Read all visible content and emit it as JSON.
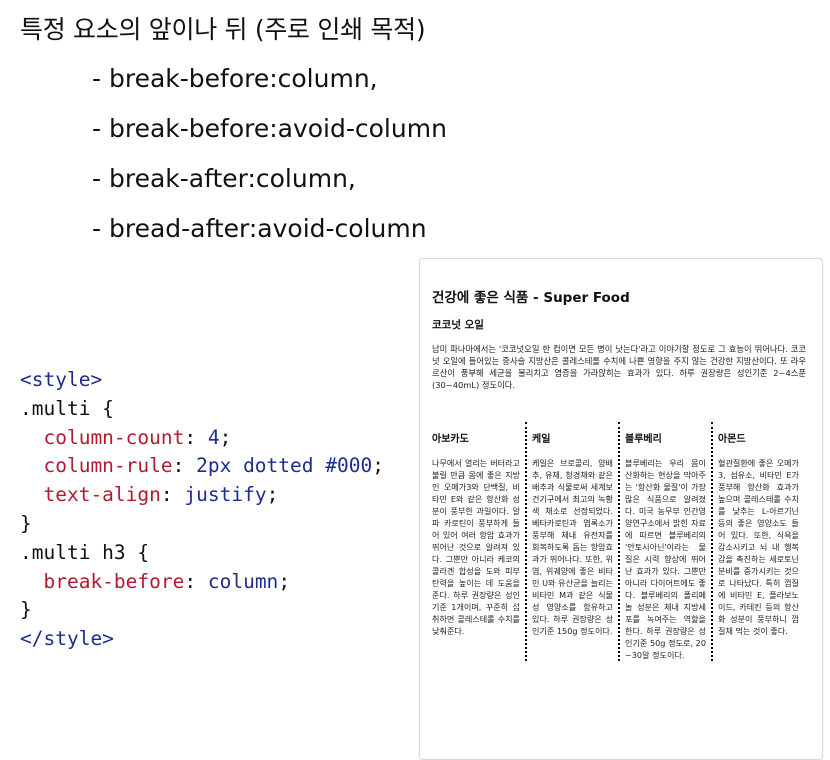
{
  "slide": {
    "title": "특정 요소의 앞이나 뒤 (주로 인쇄 목적)",
    "bullets": [
      "- break-before:column,",
      "- break-before:avoid-column",
      "- break-after:column,",
      "- bread-after:avoid-column"
    ]
  },
  "code": {
    "style_open": "<style>",
    "rule1_selector": ".multi {",
    "rule1_p1": "column-count",
    "rule1_v1": "4",
    "rule1_p2": "column-rule",
    "rule1_v2": "2px dotted #000",
    "rule1_p3": "text-align",
    "rule1_v3": "justify",
    "close_brace": "}",
    "rule2_selector": ".multi h3 {",
    "rule2_p1": "break-before",
    "rule2_v1": "column",
    "style_close": "</style>"
  },
  "demo": {
    "title": "건강에 좋은 식품 - Super Food",
    "section_title": "코코넛 오일",
    "intro": "남미 파나마에서는 '코코넛오일 한 컵이면 모든 병이 낫는다'라고 이야기할 정도로 그 효능이 뛰어나다. 코코넛 오일에 들어있는 중사슬 지방산은 콜레스테롤 수치에 나쁜 영향을 주지 않는 건강한 지방산이다. 또 라우르산이 풍부해 세균을 물리치고 염증을 가라앉히는 효과가 있다. 하루 권장량은 성인기준 2~4스푼(30~40mL) 정도이다.",
    "columns": [
      {
        "heading": "아보카도",
        "text": "나무에서 열리는 버터라고 불릴 만큼 몸에 좋은 지방인 오메가3와 단백질, 비타민 E와 같은 항산화 성분이 풍부한 과일이다. 알파 카로틴이 풍부하게 들어 있어 여러 항암 효과가 뛰어난 것으로 알려져 있다. 그뿐만 아니라 케코의 콜라겐 합성을 도와 피부 탄력을 높이는 데 도움을 준다. 하루 권장량은 성인기준 1개이며, 꾸준히 섭취하면 콜레스테롤 수치를 낮춰준다."
      },
      {
        "heading": "케일",
        "text": "케일은 브로콜리, 양배추, 유채, 청경채와 같은 배추과 식물로써 세계보건기구에서 최고의 녹황색 채소로 선정되었다. 베타카로틴과 엽록소가 풍부해 체내 유전자를 회복하도록 돕는 항암효과가 뛰어나다. 또한, 위염, 위궤양에 좋은 비타민 U와 유산균을 늘리는 비타민 M과 같은 식물성 영양소를 함유하고 있다. 하루 권장량은 성인기준 150g 정도이다."
      },
      {
        "heading": "블루베리",
        "text": "블루베리는 우리 몸이 산화하는 현상을 막아주는 '항산화 물질'이 가장 많은 식품으로 알려졌다. 미국 농무부 인간영양연구소에서 밝힌 자료에 따르면 블루베리의 '안토시아닌'이라는 물질은 시력 향상에 뛰어난 효과가 있다. 그뿐만 아니라 다이어트에도 좋다. 블루베리의 폴리페놀 성분은 체내 지방세포를 녹여주는 역할을 한다. 하루 권장량은 성인기준 50g 정도로, 20~30알 정도이다."
      },
      {
        "heading": "아몬드",
        "text": "혈관질환에 좋은 오메가3, 섬유소, 비타민 E가 풍부해 항산화 효과가 높으며 콜레스테롤 수치를 낮추는 L-아르기닌 등의 좋은 영양소도 들어 있다. 또한, 식욕을 감소시키고 뇌 내 행복감을 촉진하는 세로토닌 분비를 증가시키는 것으로 나타났다. 특히 껍질에 비타민 E, 플라보노이드, 카테킨 등의 항산화 성분이 풍부하니 껍질채 먹는 것이 좋다."
      }
    ]
  }
}
